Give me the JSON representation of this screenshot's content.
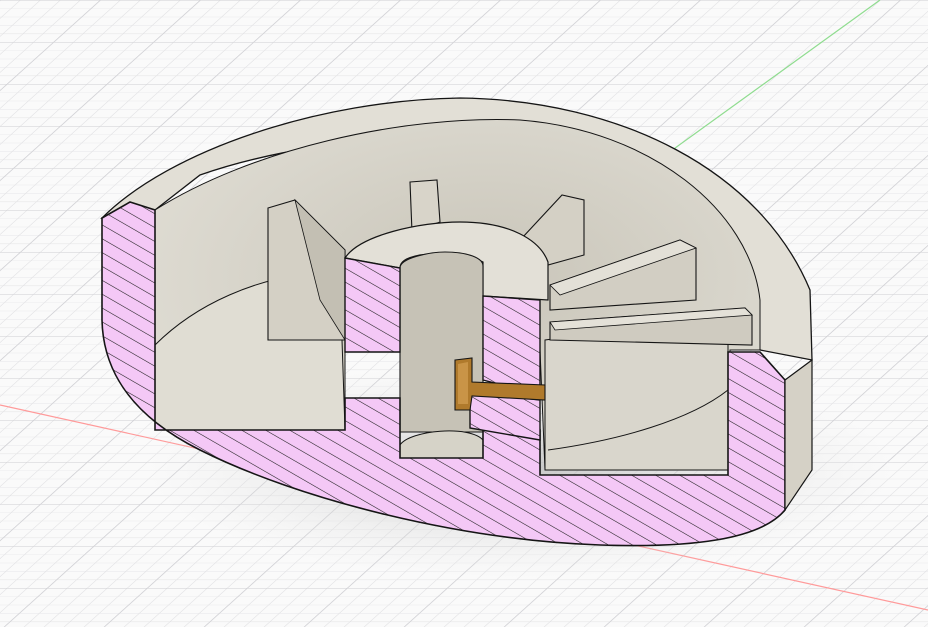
{
  "viewport": {
    "background": "#fafafa",
    "grid_minor_color": "#e4e4e6",
    "grid_major_color": "#d2d2d6",
    "x_axis_color": "#ff9a9a",
    "y_axis_color": "#8fdc8f"
  },
  "model": {
    "body_color": "#dddad0",
    "body_shade_color": "#bdb9ad",
    "section_fill_color": "#f4c8f6",
    "section_hatch_color": "#1a1a1a",
    "insert_color": "#b07a2c",
    "edge_color": "#151515",
    "shadow_color": "#c8c8c8",
    "view": "section-analysis",
    "rib_count": 5
  }
}
